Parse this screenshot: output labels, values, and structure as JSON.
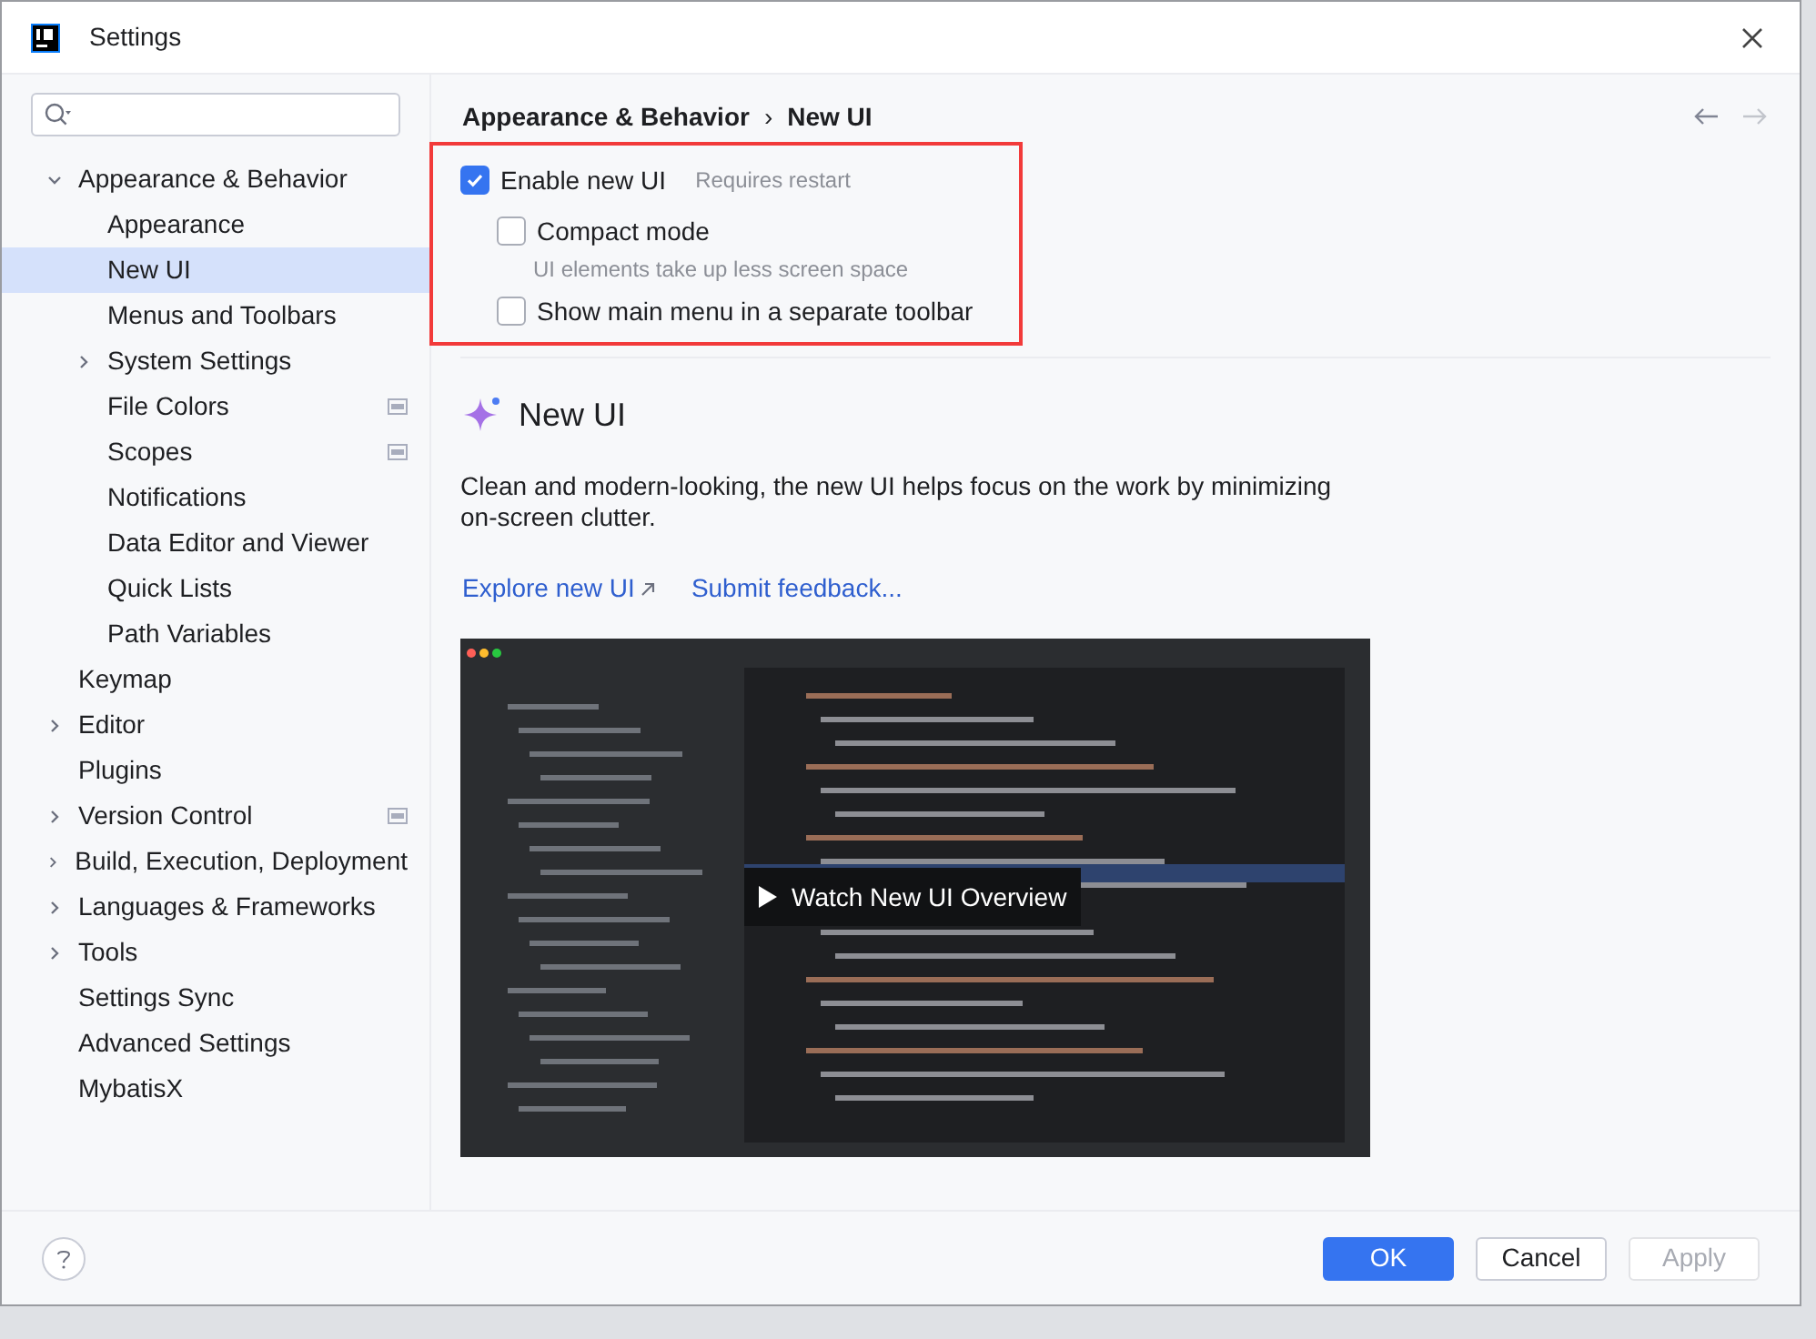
{
  "window": {
    "title": "Settings"
  },
  "sidebar": {
    "items": [
      {
        "label": "Appearance & Behavior",
        "kind": "open",
        "selected": false,
        "badge": false,
        "children": [
          {
            "label": "Appearance",
            "kind": "leaf",
            "selected": false,
            "badge": false
          },
          {
            "label": "New UI",
            "kind": "leaf",
            "selected": true,
            "badge": false
          },
          {
            "label": "Menus and Toolbars",
            "kind": "leaf",
            "selected": false,
            "badge": false
          },
          {
            "label": "System Settings",
            "kind": "closed",
            "selected": false,
            "badge": false
          },
          {
            "label": "File Colors",
            "kind": "leaf",
            "selected": false,
            "badge": true
          },
          {
            "label": "Scopes",
            "kind": "leaf",
            "selected": false,
            "badge": true
          },
          {
            "label": "Notifications",
            "kind": "leaf",
            "selected": false,
            "badge": false
          },
          {
            "label": "Data Editor and Viewer",
            "kind": "leaf",
            "selected": false,
            "badge": false
          },
          {
            "label": "Quick Lists",
            "kind": "leaf",
            "selected": false,
            "badge": false
          },
          {
            "label": "Path Variables",
            "kind": "leaf",
            "selected": false,
            "badge": false
          }
        ]
      },
      {
        "label": "Keymap",
        "kind": "leaf",
        "selected": false,
        "badge": false
      },
      {
        "label": "Editor",
        "kind": "closed",
        "selected": false,
        "badge": false
      },
      {
        "label": "Plugins",
        "kind": "leaf",
        "selected": false,
        "badge": false
      },
      {
        "label": "Version Control",
        "kind": "closed",
        "selected": false,
        "badge": true
      },
      {
        "label": "Build, Execution, Deployment",
        "kind": "closed",
        "selected": false,
        "badge": false
      },
      {
        "label": "Languages & Frameworks",
        "kind": "closed",
        "selected": false,
        "badge": false
      },
      {
        "label": "Tools",
        "kind": "closed",
        "selected": false,
        "badge": false
      },
      {
        "label": "Settings Sync",
        "kind": "leaf",
        "selected": false,
        "badge": false
      },
      {
        "label": "Advanced Settings",
        "kind": "leaf",
        "selected": false,
        "badge": false
      },
      {
        "label": "MybatisX",
        "kind": "leaf",
        "selected": false,
        "badge": false
      }
    ]
  },
  "breadcrumb": {
    "path": [
      "Appearance & Behavior",
      "New UI"
    ],
    "separator": "›"
  },
  "options": [
    {
      "label": "Enable new UI",
      "note": "Requires restart",
      "checked": true,
      "children": [
        {
          "label": "Compact mode",
          "hint": "UI elements take up less screen space",
          "checked": false
        },
        {
          "label": "Show main menu in a separate toolbar",
          "checked": false
        }
      ]
    }
  ],
  "promo": {
    "title": "New UI",
    "description": "Clean and modern-looking, the new UI helps focus on the work by minimizing on-screen clutter.",
    "links": [
      {
        "label": "Explore new UI",
        "external": true
      },
      {
        "label": "Submit feedback...",
        "external": false
      }
    ],
    "video": {
      "kind": "picture",
      "button": "Watch New UI Overview"
    }
  },
  "buttons": [
    {
      "label": "OK",
      "kind": "primary",
      "disabled": false
    },
    {
      "label": "Cancel",
      "kind": "normal",
      "disabled": false
    },
    {
      "label": "Apply",
      "kind": "normal",
      "disabled": true
    }
  ]
}
